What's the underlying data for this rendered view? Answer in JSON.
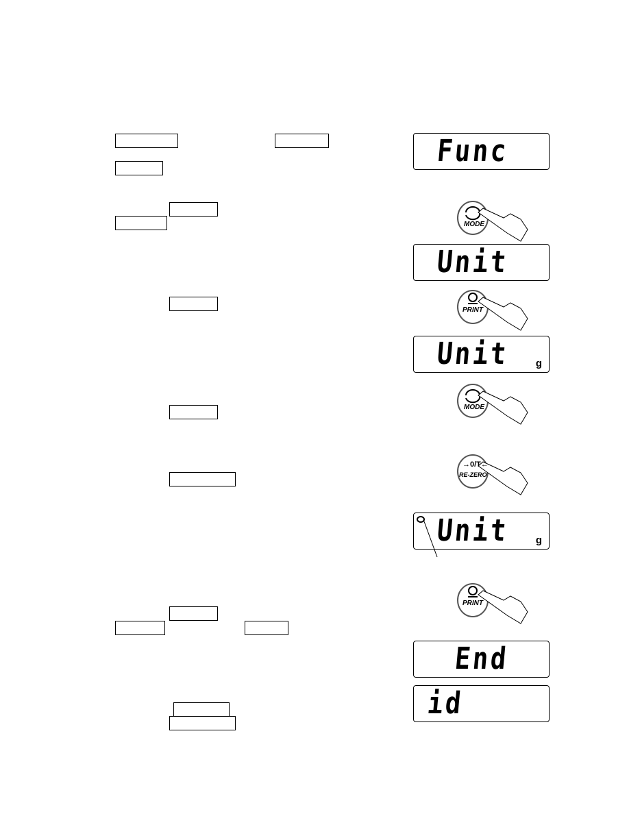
{
  "displays": [
    {
      "text": "Func",
      "unit": ""
    },
    {
      "text": "Unit",
      "unit": ""
    },
    {
      "text": "Unit",
      "unit": "g"
    },
    {
      "text": "Unit",
      "unit": "g"
    },
    {
      "text": "End",
      "unit": ""
    },
    {
      "text": "id",
      "unit": ""
    }
  ],
  "buttons": {
    "mode": "MODE",
    "print": "PRINT",
    "rezero_top": "→0/T←",
    "rezero": "RE-ZERO"
  }
}
